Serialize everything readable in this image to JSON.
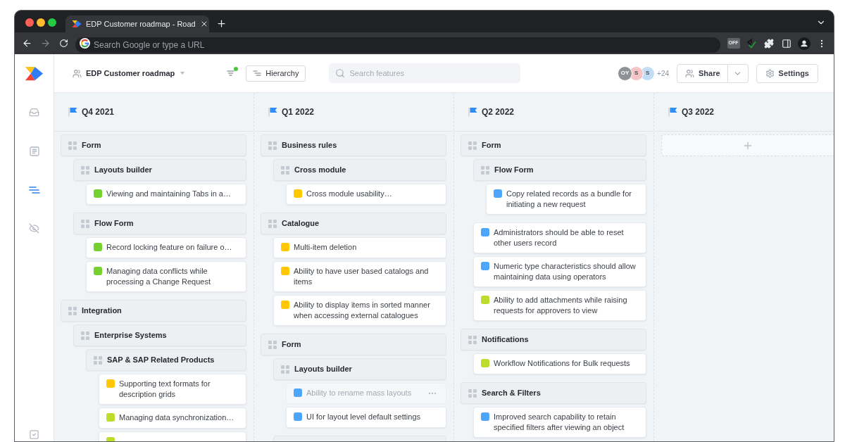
{
  "browser": {
    "tab_title": "EDP Customer roadmap - Road",
    "address_placeholder": "Search Google or type a URL",
    "extension_badge": "OFF"
  },
  "sidebar": {
    "items": [
      {
        "selected": false
      },
      {
        "selected": false
      },
      {
        "selected": true
      },
      {
        "selected": false
      },
      {
        "selected": false
      }
    ]
  },
  "header": {
    "roadmap_name": "EDP Customer roadmap",
    "filter_active": true,
    "view_button": "Hierarchy",
    "search": {
      "placeholder": "Search features"
    },
    "avatars": [
      {
        "initials": "OY",
        "color": "#8e9297"
      },
      {
        "initials": "S",
        "color": "#f6c4c4"
      },
      {
        "initials": "S",
        "color": "#c2ddf6"
      }
    ],
    "more_members": "+24",
    "share_button": "Share",
    "settings_button": "Settings"
  },
  "board": {
    "columns": [
      {
        "title": "Q4 2021",
        "items": [
          {
            "kind": "group",
            "title": "Form",
            "children": [
              {
                "kind": "group",
                "title": "Layouts builder",
                "children": [
                  {
                    "kind": "feature",
                    "title": "Viewing and maintaining Tabs in a…",
                    "color": "#74d130",
                    "hovered": false
                  }
                ]
              },
              {
                "kind": "group",
                "title": "Flow Form",
                "children": [
                  {
                    "kind": "feature",
                    "title": "Record locking feature on failure o…",
                    "color": "#74d130",
                    "hovered": false
                  },
                  {
                    "kind": "feature",
                    "title": "Managing data conflicts while processing a Change Request",
                    "color": "#74d130",
                    "hovered": false
                  }
                ]
              }
            ]
          },
          {
            "kind": "group",
            "title": "Integration",
            "children": [
              {
                "kind": "group",
                "title": "Enterprise Systems",
                "children": [
                  {
                    "kind": "group",
                    "title": "SAP & SAP Related Products",
                    "children": [
                      {
                        "kind": "feature",
                        "title": "Supporting text formats for description grids",
                        "color": "#ffc800",
                        "hovered": false
                      },
                      {
                        "kind": "feature",
                        "title": "Managing data synchronization…",
                        "color": "#bcdd2b",
                        "hovered": false
                      },
                      {
                        "kind": "feature",
                        "color": "#bcdd2b",
                        "hovered": false
                      }
                    ]
                  }
                ]
              }
            ]
          }
        ]
      },
      {
        "title": "Q1 2022",
        "items": [
          {
            "kind": "group",
            "title": "Business rules",
            "children": [
              {
                "kind": "group",
                "title": "Cross module",
                "children": [
                  {
                    "kind": "feature",
                    "title": "Cross module usability…",
                    "color": "#ffc800",
                    "hovered": false
                  }
                ]
              }
            ]
          },
          {
            "kind": "group",
            "title": "Catalogue",
            "children": [
              {
                "kind": "feature",
                "title": "Multi-item deletion",
                "color": "#ffc800",
                "hovered": false
              },
              {
                "kind": "feature",
                "title": "Ability to have user based catalogs and items",
                "color": "#ffc800",
                "hovered": false
              },
              {
                "kind": "feature",
                "title": "Ability to display items in sorted manner when accessing external catalogues",
                "color": "#ffc800",
                "hovered": false
              }
            ]
          },
          {
            "kind": "group",
            "title": "Form",
            "children": [
              {
                "kind": "group",
                "title": "Layouts builder",
                "children": [
                  {
                    "kind": "feature",
                    "title": "Ability to rename mass layouts",
                    "color": "#4ea6fb",
                    "hovered": true
                  },
                  {
                    "kind": "feature",
                    "title": "UI for layout level default settings",
                    "color": "#4ea6fb",
                    "hovered": false
                  }
                ]
              },
              {
                "kind": "group"
              }
            ]
          }
        ]
      },
      {
        "title": "Q2 2022",
        "items": [
          {
            "kind": "group",
            "title": "Form",
            "children": [
              {
                "kind": "group",
                "title": "Flow Form",
                "children": [
                  {
                    "kind": "feature",
                    "title": "Copy related records as a bundle for initiating a new request",
                    "color": "#4ea6fb",
                    "hovered": false
                  }
                ]
              },
              {
                "kind": "feature",
                "title": "Administrators should be able to reset other users record",
                "color": "#4ea6fb",
                "hovered": false
              },
              {
                "kind": "feature",
                "title": "Numeric type characteristics should allow maintaining data using operators",
                "color": "#4ea6fb",
                "hovered": false
              },
              {
                "kind": "feature",
                "title": "Ability to add attachments while raising requests for approvers to view",
                "color": "#bcdd2b",
                "hovered": false
              }
            ]
          },
          {
            "kind": "group",
            "title": "Notifications",
            "children": [
              {
                "kind": "feature",
                "title": "Workflow Notifications for Bulk requests",
                "color": "#bcdd2b",
                "hovered": false
              }
            ]
          },
          {
            "kind": "group",
            "title": "Search & Filters",
            "children": [
              {
                "kind": "feature",
                "title": "Improved search capability to retain specified filters after viewing an object",
                "color": "#4ea6fb",
                "hovered": false
              }
            ]
          }
        ]
      },
      {
        "title": "Q3 2022"
      }
    ]
  }
}
